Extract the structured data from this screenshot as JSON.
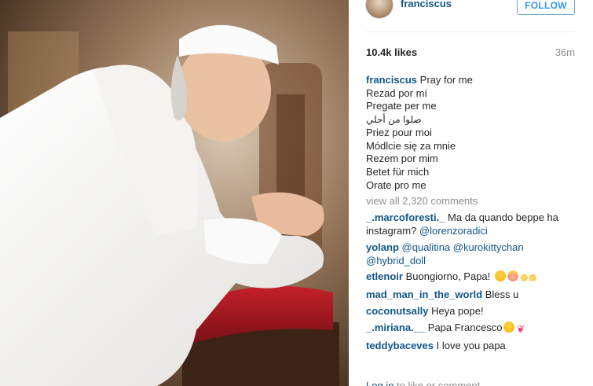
{
  "post": {
    "username": "franciscus",
    "follow_label": "FOLLOW",
    "likes": "10.4k likes",
    "time": "36m"
  },
  "caption": {
    "username": "franciscus",
    "lines": [
      "Pray for me",
      "Rezad por mí",
      "Pregate per me",
      "صلوا من أجلي",
      "Priez pour moi",
      "Módlcie się za mnie",
      "Rezem por mim",
      "Betet für mich",
      "Orate pro me"
    ]
  },
  "view_all": "view all 2,320 comments",
  "comments": [
    {
      "user": "_.marcoforesti._",
      "text": " Ma da quando beppe ha",
      "text2": "instagram? ",
      "mention": "@lorenzoradici"
    },
    {
      "user": "yolanp",
      "mention1": "@qualitina",
      "mention2": "@kurokittychan",
      "mention3": "@hybrid_doll"
    },
    {
      "user": "etlenoir",
      "text": " Buongiorno, Papa! "
    },
    {
      "user": "mad_man_in_the_world",
      "text": " Bless u"
    },
    {
      "user": "coconutsally",
      "text": " Heya pope!"
    },
    {
      "user": "_.miriana.__",
      "text": " Papa Francesco"
    },
    {
      "user": "teddybaceves",
      "text": " I love you papa"
    }
  ],
  "emoji": {
    "etlenoir": [
      "smiling-face-icon",
      "angel-face-icon",
      "open-hands-icon"
    ],
    "miriana": [
      "relieved-face-icon",
      "ribbon-icon"
    ]
  },
  "login": {
    "link": "Log in",
    "text": " to like or comment."
  },
  "colors": {
    "link": "#125688",
    "follow": "#3897f0",
    "muted": "#8e8e8e"
  }
}
